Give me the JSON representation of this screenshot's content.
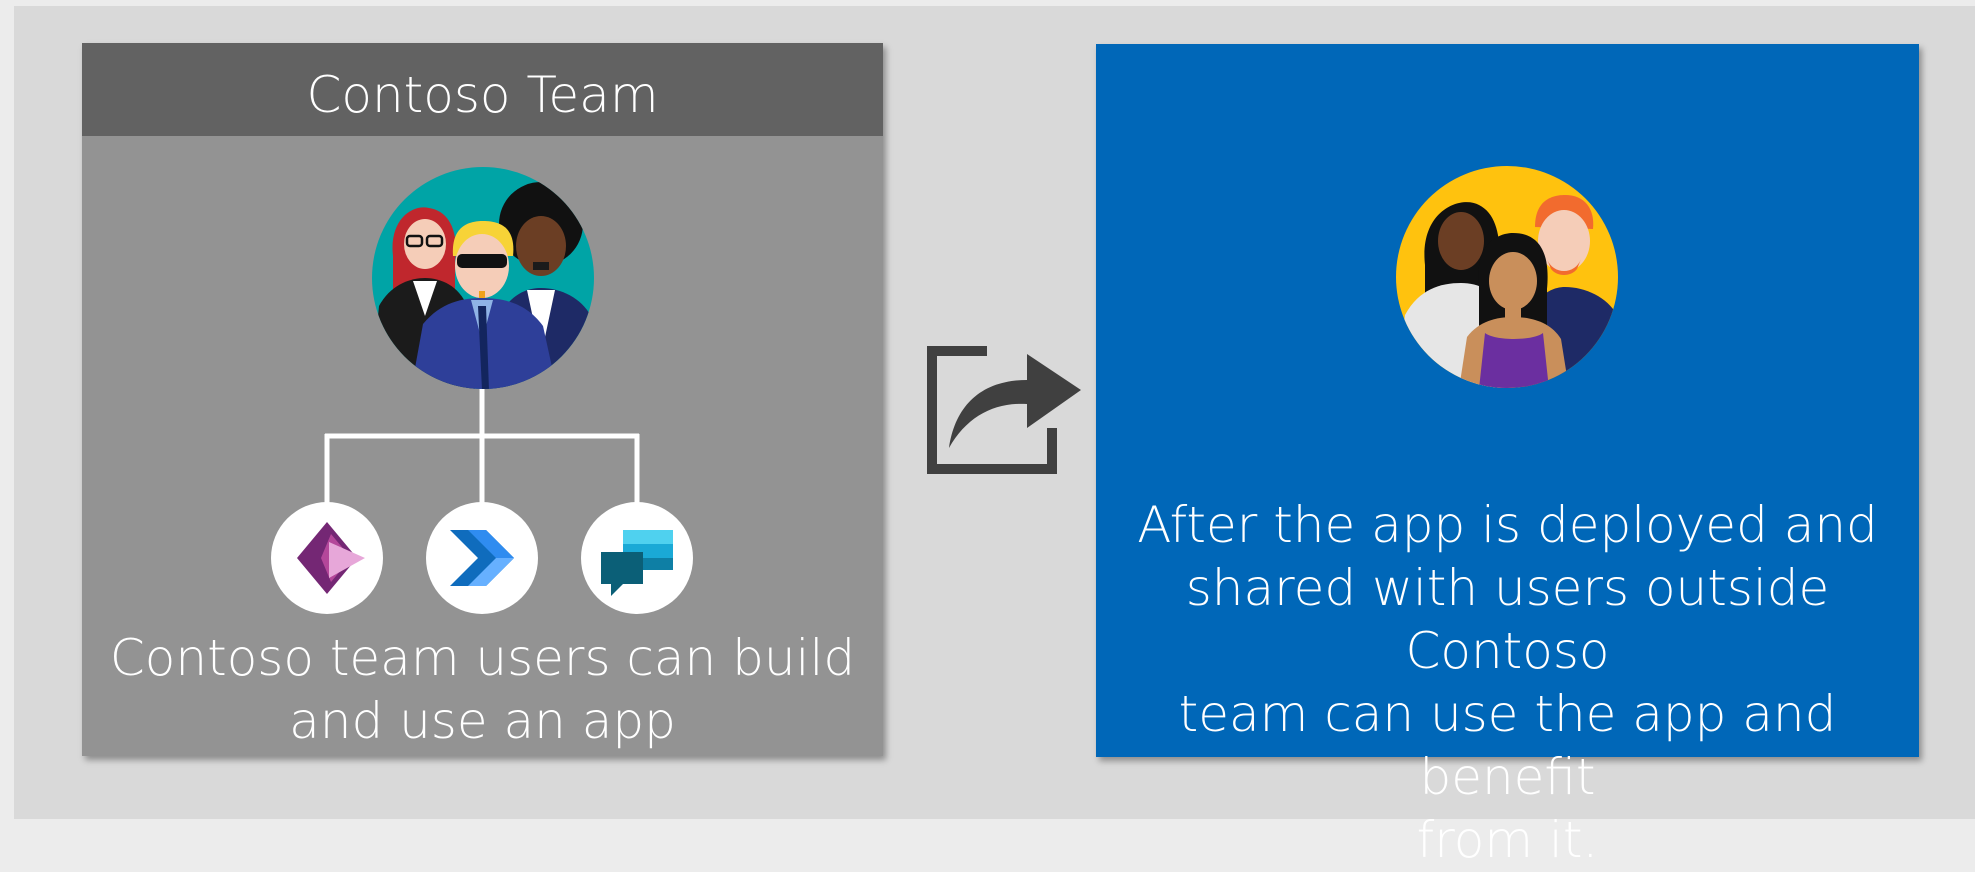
{
  "left_panel": {
    "title": "Contoso Team",
    "caption_line1": "Contoso team users can build",
    "caption_line2": "and use an app",
    "apps": [
      "power-apps-icon",
      "power-automate-icon",
      "power-virtual-agents-icon"
    ]
  },
  "share_icon": "share-arrow-icon",
  "right_panel": {
    "caption_line1": "After the app is deployed and",
    "caption_line2": "shared with users outside Contoso",
    "caption_line3": "team can use the app and benefit",
    "caption_line4": "from it."
  },
  "colors": {
    "left_panel": "#939393",
    "left_header": "#626262",
    "right_panel": "#0067b8",
    "team_avatar_bg": "#00a4a6",
    "users_avatar_bg": "#ffc20e"
  }
}
